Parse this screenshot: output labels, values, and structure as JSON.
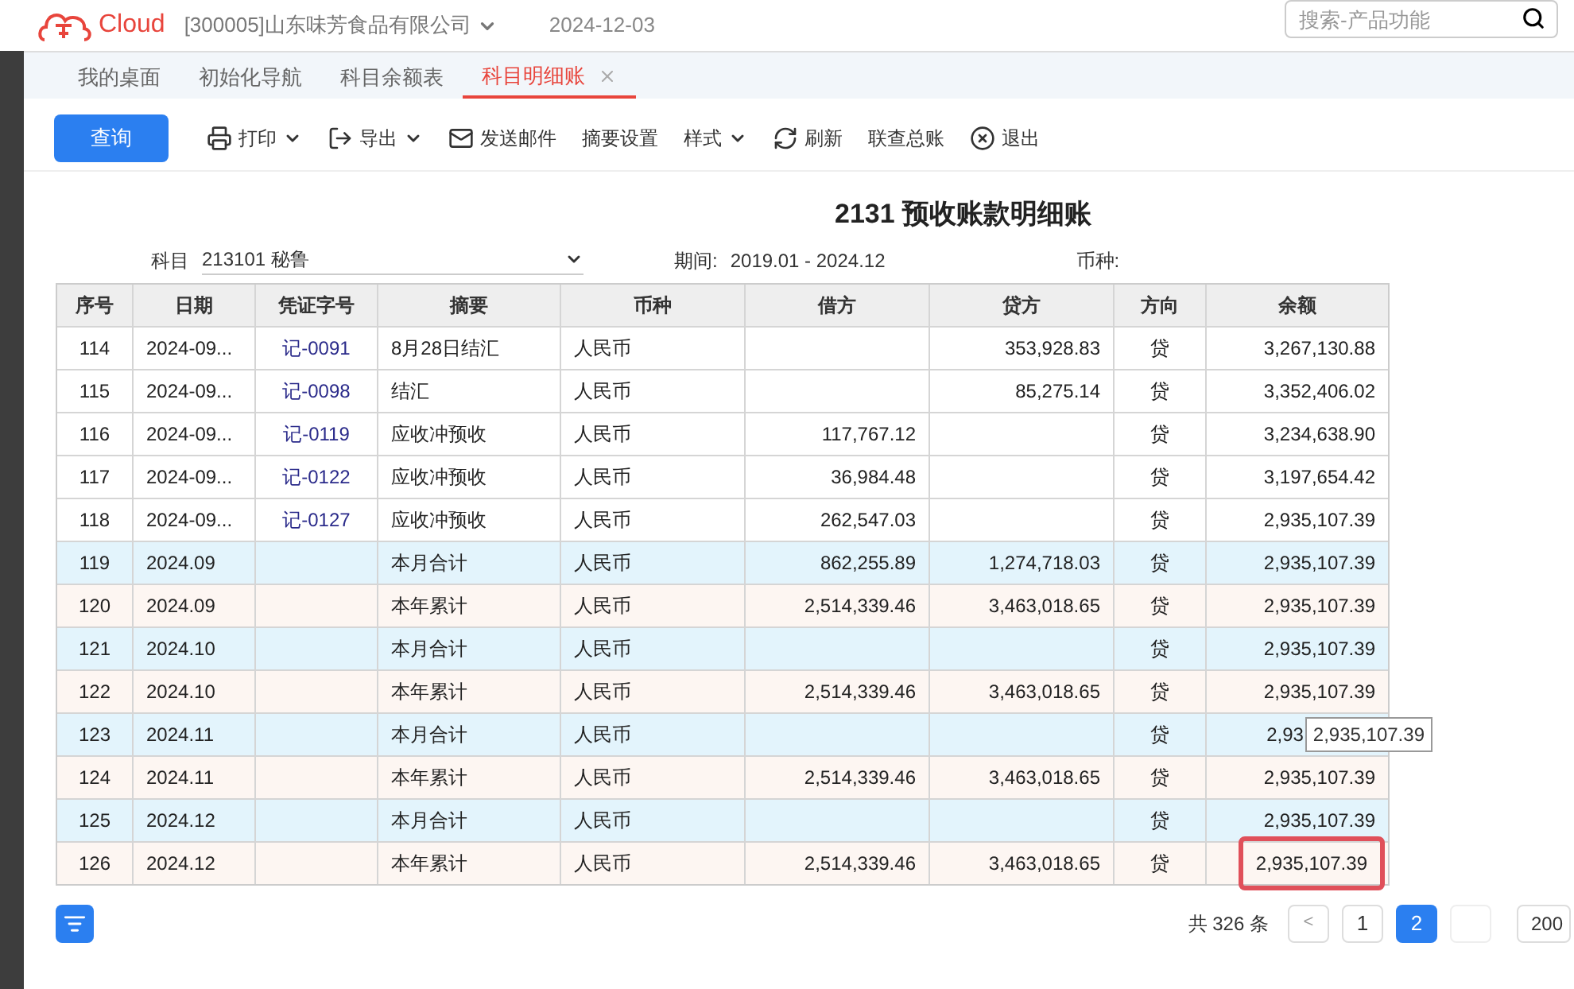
{
  "header": {
    "brand": "Cloud",
    "company": "[300005]山东味芳食品有限公司",
    "date": "2024-12-03",
    "search": {
      "placeholder": "搜索-产品功能"
    }
  },
  "tabs": [
    {
      "label": "我的桌面",
      "selected": false,
      "closable": false
    },
    {
      "label": "初始化导航",
      "selected": false,
      "closable": false
    },
    {
      "label": "科目余额表",
      "selected": false,
      "closable": false
    },
    {
      "label": "科目明细账",
      "selected": true,
      "closable": true
    }
  ],
  "toolbar": [
    {
      "kind": "primary",
      "label": "查询"
    },
    {
      "kind": "print",
      "label": "打印"
    },
    {
      "kind": "export",
      "label": "导出"
    },
    {
      "kind": "mail",
      "label": "发送邮件"
    },
    {
      "kind": "plain",
      "label": "摘要设置"
    },
    {
      "kind": "style",
      "label": "样式"
    },
    {
      "kind": "refresh",
      "label": "刷新"
    },
    {
      "kind": "plain",
      "label": "联查总账"
    },
    {
      "kind": "exit",
      "label": "退出"
    }
  ],
  "report": {
    "title": "2131 预收账款明细账",
    "account_label": "科目",
    "account_value": "213101 秘鲁",
    "period_label": "期间:",
    "period_value": "2019.01 - 2024.12",
    "currency_label": "币种:"
  },
  "table": {
    "columns": [
      "序号",
      "日期",
      "凭证字号",
      "摘要",
      "币种",
      "借方",
      "贷方",
      "方向",
      "余额"
    ],
    "rows": [
      {
        "kind": "entry",
        "cells": [
          "114",
          "2024-09...",
          "记-0091",
          "8月28日结汇",
          "人民币",
          "",
          "353,928.83",
          "贷",
          "3,267,130.88"
        ],
        "highlighted": false
      },
      {
        "kind": "entry",
        "cells": [
          "115",
          "2024-09...",
          "记-0098",
          "结汇",
          "人民币",
          "",
          "85,275.14",
          "贷",
          "3,352,406.02"
        ],
        "highlighted": false
      },
      {
        "kind": "entry",
        "cells": [
          "116",
          "2024-09...",
          "记-0119",
          "应收冲预收",
          "人民币",
          "117,767.12",
          "",
          "贷",
          "3,234,638.90"
        ],
        "highlighted": false
      },
      {
        "kind": "entry",
        "cells": [
          "117",
          "2024-09...",
          "记-0122",
          "应收冲预收",
          "人民币",
          "36,984.48",
          "",
          "贷",
          "3,197,654.42"
        ],
        "highlighted": false
      },
      {
        "kind": "entry",
        "cells": [
          "118",
          "2024-09...",
          "记-0127",
          "应收冲预收",
          "人民币",
          "262,547.03",
          "",
          "贷",
          "2,935,107.39"
        ],
        "highlighted": false
      },
      {
        "kind": "month_total",
        "cells": [
          "119",
          "2024.09",
          "",
          "本月合计",
          "人民币",
          "862,255.89",
          "1,274,718.03",
          "贷",
          "2,935,107.39"
        ],
        "highlighted": false
      },
      {
        "kind": "year_total",
        "cells": [
          "120",
          "2024.09",
          "",
          "本年累计",
          "人民币",
          "2,514,339.46",
          "3,463,018.65",
          "贷",
          "2,935,107.39"
        ],
        "highlighted": false
      },
      {
        "kind": "month_total",
        "cells": [
          "121",
          "2024.10",
          "",
          "本月合计",
          "人民币",
          "",
          "",
          "贷",
          "2,935,107.39"
        ],
        "highlighted": false
      },
      {
        "kind": "year_total",
        "cells": [
          "122",
          "2024.10",
          "",
          "本年累计",
          "人民币",
          "2,514,339.46",
          "3,463,018.65",
          "贷",
          "2,935,107.39"
        ],
        "highlighted": false
      },
      {
        "kind": "month_total",
        "cells": [
          "123",
          "2024.11",
          "",
          "本月合计",
          "人民币",
          "",
          "",
          "贷",
          "2,93"
        ],
        "highlighted": false,
        "tooltip": "2,935,107.39"
      },
      {
        "kind": "year_total",
        "cells": [
          "124",
          "2024.11",
          "",
          "本年累计",
          "人民币",
          "2,514,339.46",
          "3,463,018.65",
          "贷",
          "2,935,107.39"
        ],
        "highlighted": false
      },
      {
        "kind": "month_total",
        "cells": [
          "125",
          "2024.12",
          "",
          "本月合计",
          "人民币",
          "",
          "",
          "贷",
          "2,935,107.39"
        ],
        "highlighted": false
      },
      {
        "kind": "year_total",
        "cells": [
          "126",
          "2024.12",
          "",
          "本年累计",
          "人民币",
          "2,514,339.46",
          "3,463,018.65",
          "贷",
          "2,935,107.39"
        ],
        "highlighted": true
      }
    ]
  },
  "pagination": {
    "total": "共 326 条",
    "prev": "<",
    "pages": [
      {
        "label": "1",
        "selected": false
      },
      {
        "label": "2",
        "selected": true
      }
    ],
    "page_size": "200"
  }
}
